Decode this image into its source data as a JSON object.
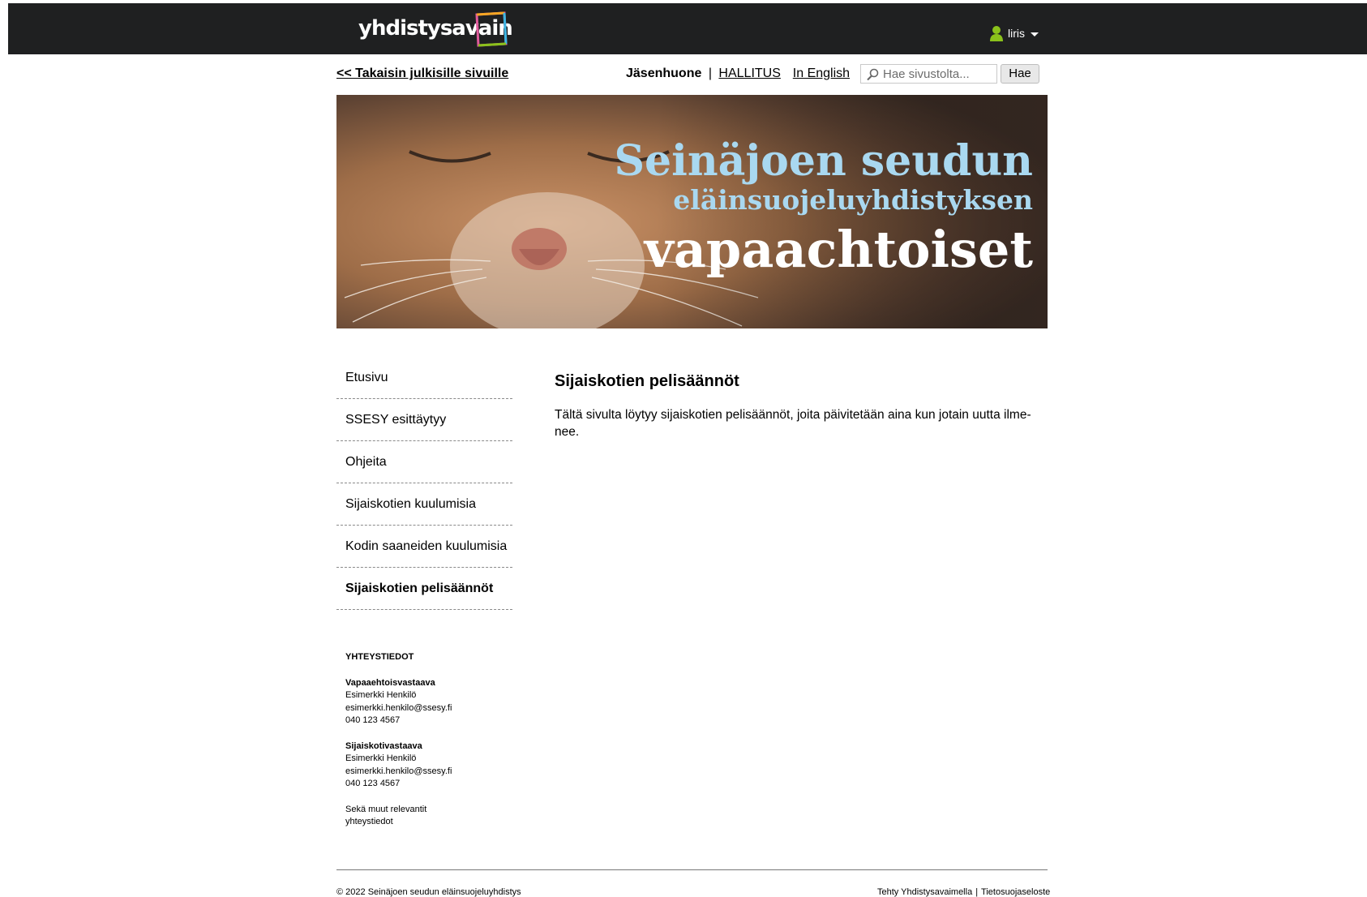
{
  "header": {
    "logo_text": "yhdistysavain",
    "user_name": "liris"
  },
  "subnav": {
    "back_link": "<< Takaisin julkisille sivuille",
    "member_room": "Jäsenhuone",
    "separator": "|",
    "board_link": "HALLITUS",
    "english_link": "In English",
    "search_placeholder": "Hae sivustolta...",
    "search_button": "Hae"
  },
  "banner": {
    "line1": "Seinäjoen seudun",
    "line2": "eläinsuojeluyhdistyksen",
    "line3": "vapaachtoiset"
  },
  "sidebar": {
    "items": [
      {
        "label": "Etusivu",
        "active": false
      },
      {
        "label": "SSESY esittäytyy",
        "active": false
      },
      {
        "label": "Ohjeita",
        "active": false
      },
      {
        "label": "Sijaiskotien kuulumisia",
        "active": false
      },
      {
        "label": "Kodin saaneiden kuulumisia",
        "active": false
      },
      {
        "label": "Sijaiskotien pelisäännöt",
        "active": true
      }
    ]
  },
  "contact": {
    "heading": "YHTEYSTIEDOT",
    "blocks": [
      {
        "role": "Vapaaehtoisvastaava",
        "name": "Esimerkki Henkilö",
        "email": "esimerkki.henkilo@ssesy.fi",
        "phone": "040 123 4567"
      },
      {
        "role": "Sijaiskotivastaava",
        "name": "Esimerkki Henkilö",
        "email": "esimerkki.henkilo@ssesy.fi",
        "phone": "040 123 4567"
      }
    ],
    "other_line1": "Sekä muut relevantit",
    "other_line2": "yhteystiedot"
  },
  "main": {
    "title": "Sijaiskotien pelisäännöt",
    "text": "Tältä sivulta löytyy sijaiskotien pelisäännöt, joita päivitetään aina kun jotain uutta ilme- nee."
  },
  "footer": {
    "copyright": "© 2022 Seinäjoen seudun eläinsuojeluyhdistys",
    "made_with": "Tehty Yhdistysavaimella",
    "bar": "|",
    "privacy": "Tietosuojaseloste"
  },
  "colors": {
    "topbar": "#1f2021",
    "banner_title_blue": "#a9d8f0",
    "user_icon_green": "#8bc21b"
  }
}
